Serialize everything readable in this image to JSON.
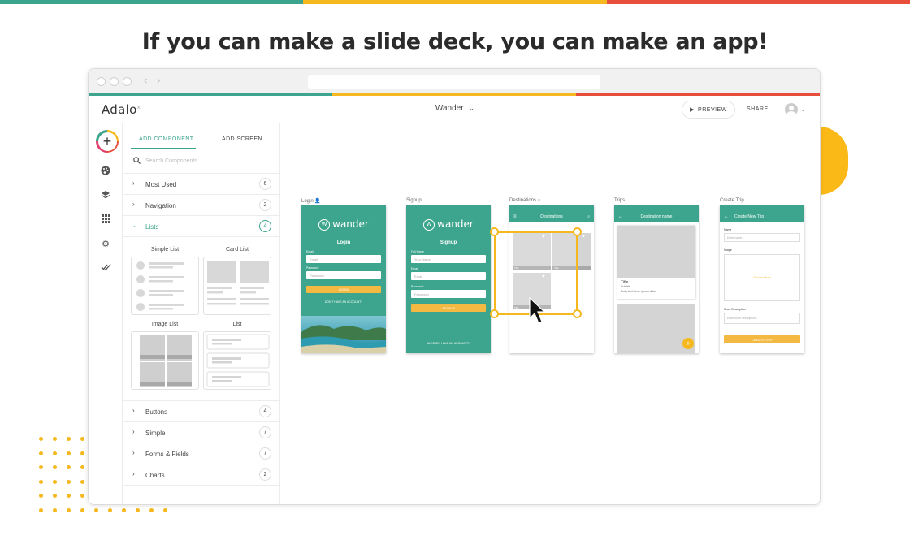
{
  "colors": {
    "teal": "#3da58d",
    "yellow": "#f5b91f",
    "red": "#e84e3c",
    "headline": "#2b2b2b"
  },
  "headline": "If you can make a slide deck, you can make an app!",
  "app": {
    "logo": "Adalo",
    "logo_mark": "x",
    "app_name": "Wander",
    "preview_label": "PREVIEW",
    "share_label": "SHARE"
  },
  "panel": {
    "tab_add_component": "ADD COMPONENT",
    "tab_add_screen": "ADD SCREEN",
    "search_placeholder": "Search Components...",
    "categories": [
      {
        "label": "Most Used",
        "count": "6"
      },
      {
        "label": "Navigation",
        "count": "2"
      },
      {
        "label": "Lists",
        "count": "4"
      },
      {
        "label": "Buttons",
        "count": "4"
      },
      {
        "label": "Simple",
        "count": "7"
      },
      {
        "label": "Forms & Fields",
        "count": "7"
      },
      {
        "label": "Charts",
        "count": "2"
      }
    ],
    "list_types": [
      "Simple List",
      "Card List",
      "Image List",
      "List"
    ]
  },
  "screens": {
    "login": {
      "label": "Login",
      "brand": "wander",
      "title": "Login",
      "email_label": "Email",
      "email_placeholder": "Email",
      "password_label": "Password",
      "password_placeholder": "Password",
      "button": "LOGIN",
      "link": "DON'T HAVE AN ACCOUNT?"
    },
    "signup": {
      "label": "Signup",
      "brand": "wander",
      "title": "Signup",
      "name_label": "Full Name",
      "name_placeholder": "Your Name",
      "email_label": "Email",
      "email_placeholder": "Email",
      "password_label": "Password",
      "password_placeholder": "Password",
      "button": "SIGNUP",
      "link": "ALREADY HAVE AN ACCOUNT?"
    },
    "destinations": {
      "label": "Destinations",
      "title": "Destinations",
      "tile_label": "Title"
    },
    "trips": {
      "label": "Trips",
      "title": "Destination name",
      "card_title": "Title",
      "card_subtitle": "Subtitle",
      "card_body": "Body text lorem ipsum dolor"
    },
    "create_trip": {
      "label": "Create Trip",
      "title": "Create New Trip",
      "name_label": "Name",
      "name_placeholder": "Enter name...",
      "image_label": "Image",
      "image_link": "Choose Photo",
      "desc_label": "Short Description",
      "desc_placeholder": "Enter short description...",
      "button": "CREATE TRIP"
    }
  }
}
